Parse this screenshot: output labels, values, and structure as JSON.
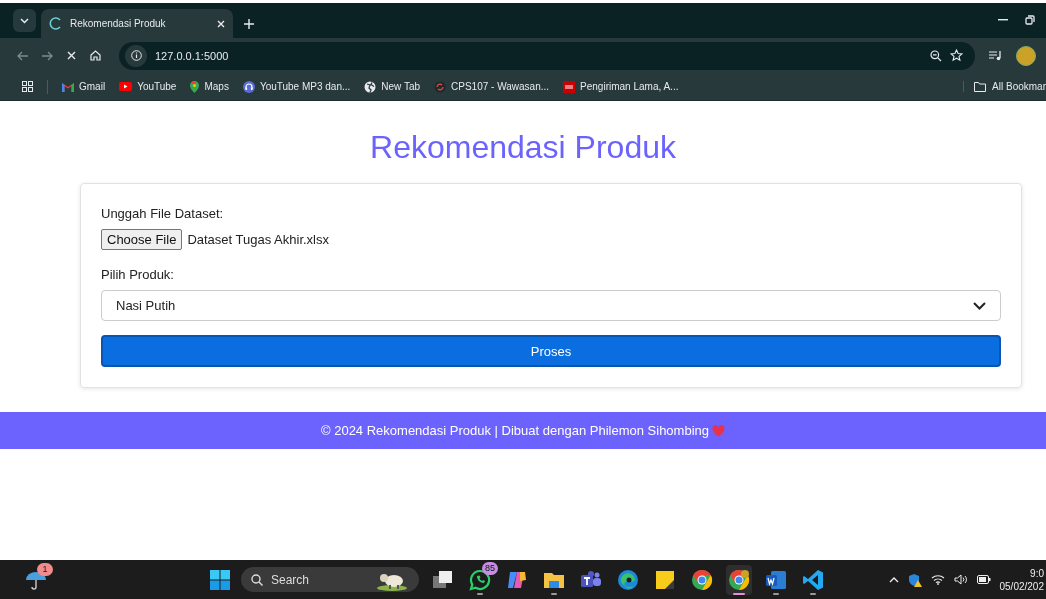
{
  "browser": {
    "tab": {
      "title": "Rekomendasi Produk",
      "loading": true
    },
    "url": "127.0.0.1:5000",
    "bookmarks": [
      {
        "kind": "gmail",
        "label": "Gmail"
      },
      {
        "kind": "youtube",
        "label": "YouTube"
      },
      {
        "kind": "maps",
        "label": "Maps"
      },
      {
        "kind": "headphones",
        "label": "YouTube MP3 dan..."
      },
      {
        "kind": "globe",
        "label": "New Tab"
      },
      {
        "kind": "swirl",
        "label": "CPS107 - Wawasan..."
      },
      {
        "kind": "cnn",
        "label": "Pengiriman Lama, A..."
      }
    ],
    "all_bookmarks": "All Bookmar"
  },
  "page": {
    "title": "Rekomendasi Produk",
    "file_label": "Unggah File Dataset:",
    "file_button": "Choose File",
    "file_name": "Dataset Tugas Akhir.xlsx",
    "product_label": "Pilih Produk:",
    "product_value": "Nasi Putih",
    "submit": "Proses",
    "footer": "© 2024 Rekomendasi Produk | Dibuat dengan Philemon Sihombing"
  },
  "taskbar": {
    "weather_badge": "1",
    "search": {
      "placeholder": "Search"
    },
    "apps": [
      {
        "kind": "taskview",
        "running": false,
        "selected": false
      },
      {
        "kind": "whatsapp",
        "running": true,
        "selected": false,
        "badge": "85"
      },
      {
        "kind": "copilot",
        "running": false,
        "selected": false
      },
      {
        "kind": "files",
        "running": true,
        "selected": false
      },
      {
        "kind": "teams",
        "running": false,
        "selected": false
      },
      {
        "kind": "edge",
        "running": false,
        "selected": false
      },
      {
        "kind": "sticky",
        "running": false,
        "selected": false
      },
      {
        "kind": "chrome",
        "running": false,
        "selected": false
      },
      {
        "kind": "chrome-profile",
        "running": true,
        "selected": true
      },
      {
        "kind": "word",
        "running": true,
        "selected": false
      },
      {
        "kind": "vscode",
        "running": true,
        "selected": false
      }
    ],
    "time": "9:0",
    "date": "05/02/202"
  }
}
